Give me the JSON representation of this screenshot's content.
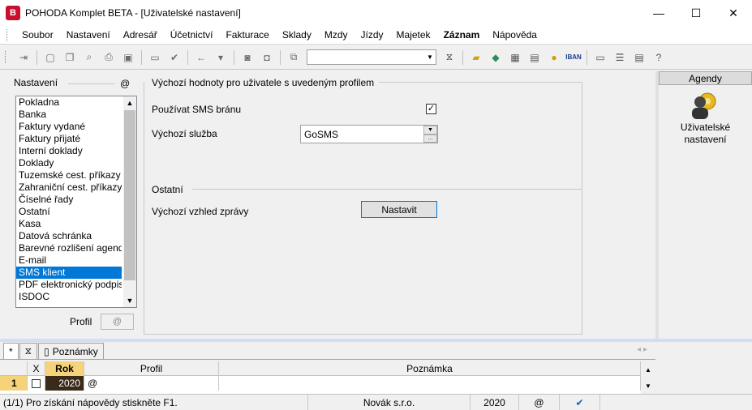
{
  "window": {
    "title": "POHODA Komplet BETA - [Uživatelské nastavení]",
    "app_icon_text": "B",
    "controls": [
      "—",
      "☐",
      "✕"
    ]
  },
  "menu": [
    "Soubor",
    "Nastavení",
    "Adresář",
    "Účetnictví",
    "Fakturace",
    "Sklady",
    "Mzdy",
    "Jízdy",
    "Majetek",
    "Záznam",
    "Nápověda"
  ],
  "toolbar": {
    "icons": [
      "exit-icon",
      "new-icon",
      "copy-icon",
      "preview-icon",
      "print-icon",
      "save-icon",
      "delete-icon",
      "check-icon",
      "back-icon",
      "forward-icon",
      "disk-icon",
      "disk2-icon",
      "copy-doc-icon",
      "filter-icon",
      "folder-icon",
      "money-icon",
      "calculator-icon",
      "calculator2-icon",
      "coins-icon",
      "iban-icon",
      "card-icon",
      "list-icon",
      "notes-icon",
      "help-icon"
    ],
    "combo_value": "",
    "iban_text": "IBAN"
  },
  "left": {
    "heading": "Nastavení",
    "at": "@",
    "items": [
      "Pokladna",
      "Banka",
      "Faktury vydané",
      "Faktury přijaté",
      "Interní doklady",
      "Doklady",
      "Tuzemské cest. příkazy",
      "Zahraniční cest. příkazy",
      "Číselné řady",
      "Ostatní",
      "Kasa",
      "Datová schránka",
      "Barevné rozlišení agend",
      "E-mail",
      "SMS klient",
      "PDF elektronický podpis",
      "ISDOC"
    ],
    "selected_index": 14,
    "profil_label": "Profil",
    "profil_value": "@"
  },
  "main": {
    "section1_title": "Výchozí hodnoty pro uživatele s uvedeným profilem",
    "sms_label": "Používat SMS bránu",
    "sms_checked": "✓",
    "sluzba_label": "Výchozí služba",
    "sluzba_value": "GoSMS",
    "section2_title": "Ostatní",
    "vzhled_label": "Výchozí vzhled zprávy",
    "nastavit_label": "Nastavit"
  },
  "agendy": {
    "title": "Agendy",
    "item_label_line1": "Uživatelské",
    "item_label_line2": "nastavení"
  },
  "tabs": {
    "star": "*",
    "filter": "filter-icon",
    "poznamky": "Poznámky"
  },
  "grid": {
    "headers": [
      "X",
      "Rok",
      "Profil",
      "Poznámka"
    ],
    "row": {
      "num": "1",
      "x": "",
      "rok": "2020",
      "profil": "@",
      "poznamka": ""
    }
  },
  "status": {
    "help": "(1/1) Pro získání nápovědy stiskněte F1.",
    "company": "Novák s.r.o.",
    "year": "2020",
    "at": "@"
  },
  "colors": {
    "selection": "#0078d7",
    "accent_band": "#cfe0f4",
    "row_year_bg": "#3a2a1a",
    "row_num_bg": "#f5d37a"
  }
}
